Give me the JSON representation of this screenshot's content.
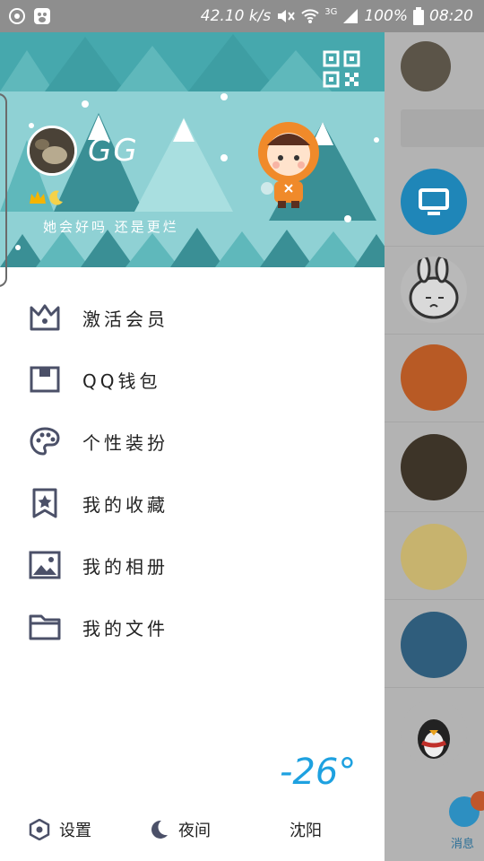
{
  "status_bar": {
    "speed": "42.10 k/s",
    "network": "3G",
    "battery": "100%",
    "time": "08:20"
  },
  "profile": {
    "name": "GG",
    "signature": "她会好吗 还是更烂"
  },
  "menu": {
    "items": [
      {
        "label": "激活会员",
        "icon": "crown-icon"
      },
      {
        "label": "QQ钱包",
        "icon": "wallet-icon"
      },
      {
        "label": "个性装扮",
        "icon": "palette-icon"
      },
      {
        "label": "我的收藏",
        "icon": "star-bookmark-icon"
      },
      {
        "label": "我的相册",
        "icon": "photo-icon"
      },
      {
        "label": "我的文件",
        "icon": "folder-icon"
      }
    ]
  },
  "weather": {
    "temperature": "-26°",
    "city": "沈阳"
  },
  "bottom_bar": {
    "settings_label": "设置",
    "night_label": "夜间"
  },
  "background": {
    "message_tab_label": "消息"
  },
  "colors": {
    "accent": "#1ea1e0",
    "icon_stroke": "#4b5068",
    "header_teal": "#46a8ad"
  }
}
